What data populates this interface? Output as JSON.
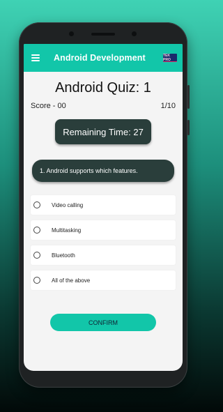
{
  "app_bar": {
    "title": "Android Development",
    "brand_badge": "TEK PRO"
  },
  "quiz": {
    "title": "Android Quiz: 1",
    "score": "Score - 00",
    "progress": "1/10",
    "remaining_time": "Remaining Time: 27",
    "question": "1. Android supports which features.",
    "options": [
      {
        "label": "Video calling"
      },
      {
        "label": "Multitasking"
      },
      {
        "label": "Bluetooth"
      },
      {
        "label": "All of the above"
      }
    ],
    "confirm_label": "CONFIRM"
  },
  "colors": {
    "accent": "#12c6a9",
    "dark_card": "#2a3e3b",
    "screen_bg": "#f4f4f4"
  }
}
